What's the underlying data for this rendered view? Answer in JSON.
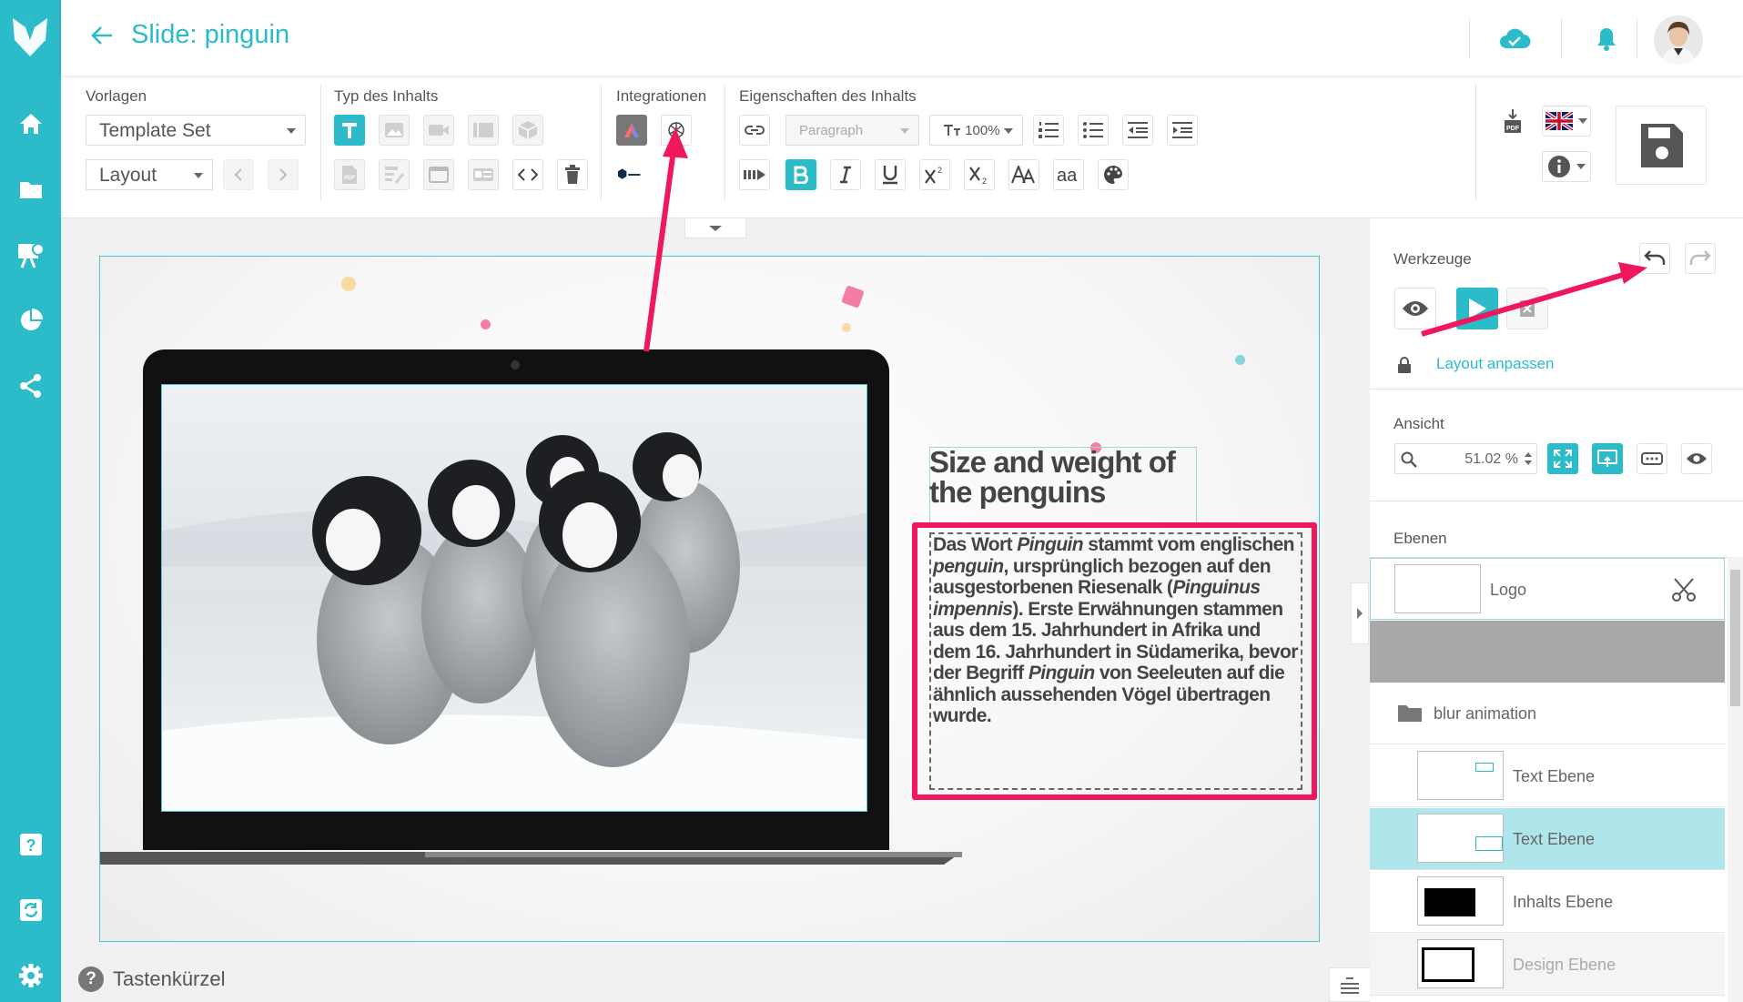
{
  "header": {
    "title": "Slide: pinguin"
  },
  "toolbar": {
    "vorlagen_label": "Vorlagen",
    "typ_label": "Typ des Inhalts",
    "integrationen_label": "Integrationen",
    "eigenschaften_label": "Eigenschaften des Inhalts",
    "template_set": "Template Set",
    "layout": "Layout",
    "paragraph": "Paragraph",
    "font_size": "100%",
    "pdf_label": "PDF",
    "language_flag": "uk-flag-icon"
  },
  "canvas": {
    "heading": "Size and weight of the penguins",
    "body_html_parts": [
      "Das Wort ",
      "Pinguin",
      " stammt vom englischen ",
      "penguin",
      ", ursprünglich bezogen auf den ausgestorbenen Riesenalk (",
      "Pinguinus impennis",
      "). Erste Erwähnungen stammen aus dem 15. Jahrhundert in Afrika und dem 16. Jahrhundert in Südamerika, bevor der Begriff ",
      "Pinguin",
      " von Seeleuten auf die ähnlich aussehenden Vögel übertragen wurde."
    ]
  },
  "footer": {
    "shortcut_label": "Tastenkürzel"
  },
  "right_panel": {
    "werkzeuge_label": "Werkzeuge",
    "layout_lock_label": "Layout anpassen",
    "ansicht_label": "Ansicht",
    "zoom_value": "51.02 %",
    "ebenen_label": "Ebenen",
    "layers": [
      {
        "name": "Logo"
      },
      {
        "name": "blur animation"
      },
      {
        "name": "Text Ebene"
      },
      {
        "name": "Text Ebene"
      },
      {
        "name": "Inhalts Ebene"
      },
      {
        "name": "Design Ebene"
      }
    ]
  },
  "colors": {
    "accent": "#2bbbc9",
    "highlight": "#f0185c",
    "selected_layer": "#aee6ec"
  }
}
